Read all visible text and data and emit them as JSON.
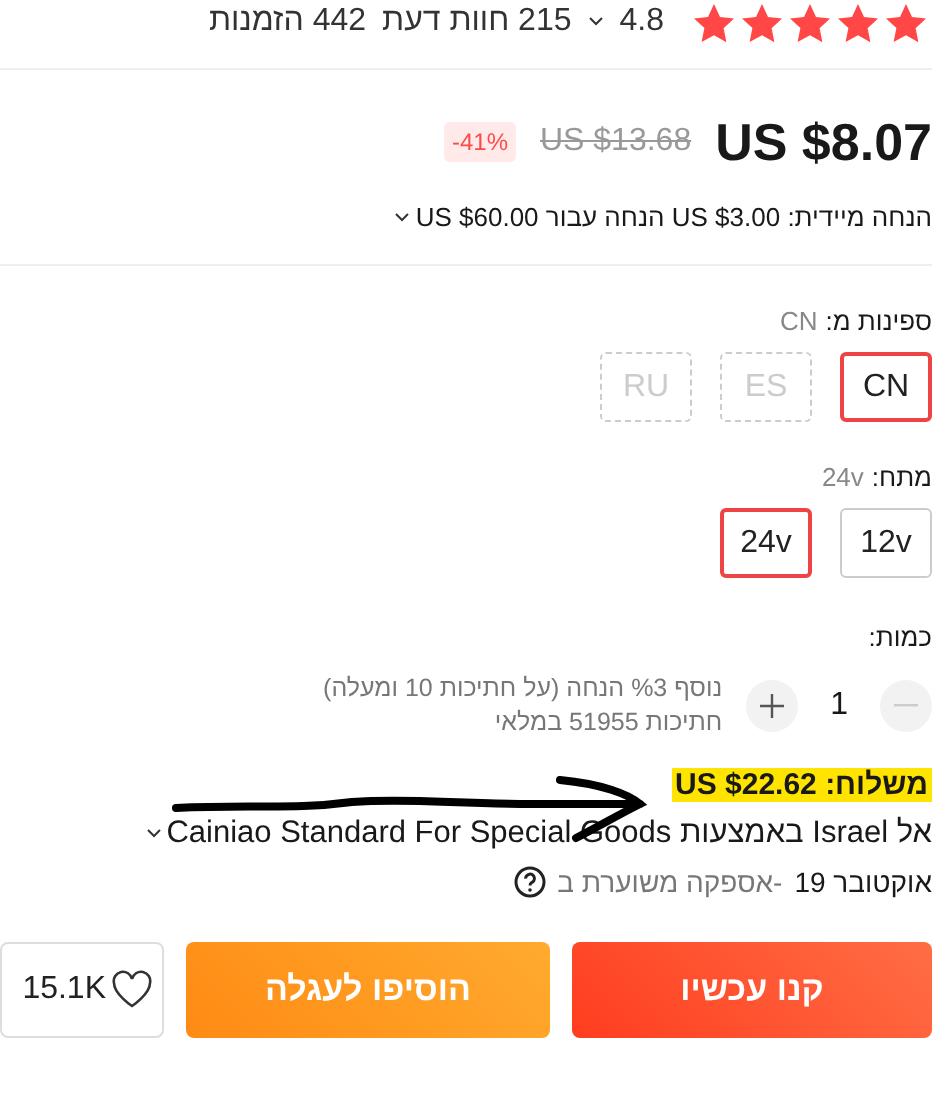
{
  "rating": {
    "stars": 5,
    "score": "4.8",
    "reviews": "215 חוות דעת",
    "orders": "442 הזמנות"
  },
  "price": {
    "current": "US $8.07",
    "original": "US $13.68",
    "discount": "-41%"
  },
  "promo": "הנחה מיידית: US $3.00 הנחה עבור US $60.00",
  "options": [
    {
      "label": "ספינות מ:",
      "value": "CN",
      "choices": [
        {
          "text": "CN",
          "selected": true,
          "disabled": false
        },
        {
          "text": "ES",
          "selected": false,
          "disabled": true
        },
        {
          "text": "RU",
          "selected": false,
          "disabled": true
        }
      ]
    },
    {
      "label": "מתח:",
      "value": "24v",
      "choices": [
        {
          "text": "12v",
          "selected": false,
          "disabled": false
        },
        {
          "text": "24v",
          "selected": true,
          "disabled": false
        }
      ]
    }
  ],
  "quantity": {
    "label": "כמות:",
    "value": "1",
    "decrease_disabled": true,
    "notes": [
      "נוסף %3 הנחה (על חתיכות 10 ומעלה)",
      "חתיכות 51955 במלאי"
    ]
  },
  "shipping": {
    "label": "משלוח:",
    "price": "US $22.62",
    "highlighted": true,
    "route": "אל Israel באמצעות Cainiao Standard For Special Goods",
    "delivery_date": "אוקטובר 19",
    "delivery_label": "-אספקה משוערת ב"
  },
  "buttons": {
    "buy": "קנו עכשיו",
    "cart": "הוסיפו לעגלה",
    "wishlist_count": "15.1K"
  }
}
